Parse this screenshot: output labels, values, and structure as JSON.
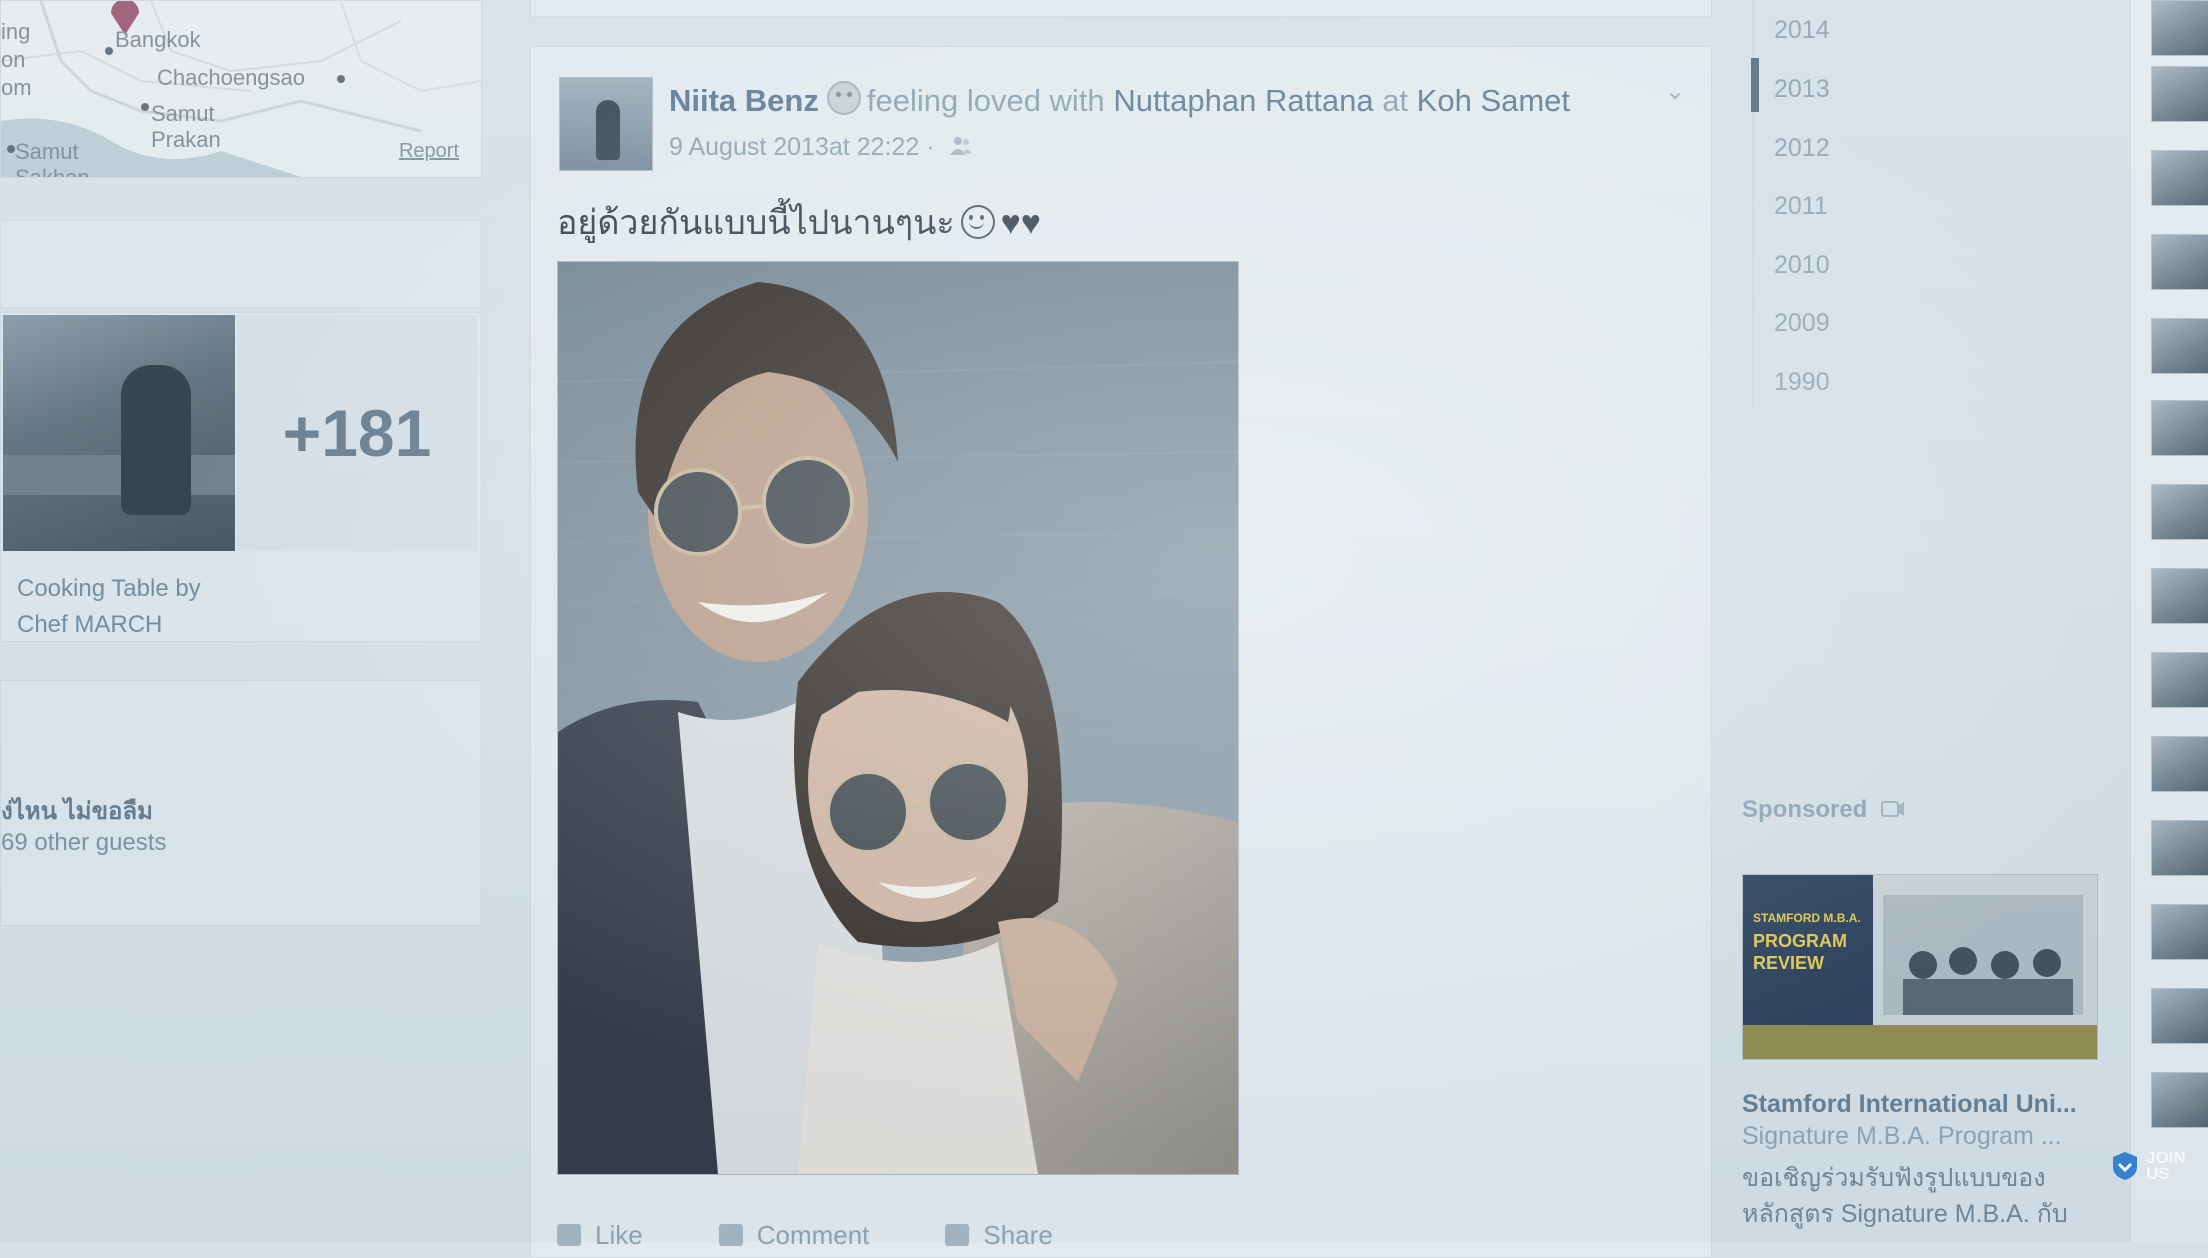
{
  "map": {
    "labels": [
      "ing",
      "on",
      "om",
      "Bangkok",
      "Chachoengsao",
      "Samut",
      "Prakan",
      "Samut",
      "Sakhon"
    ],
    "report": "Report"
  },
  "photos": {
    "more_count": "+181",
    "caption": "Cooking Table by Chef MARCH"
  },
  "event": {
    "title": "ง่ไหน ไม่ขอลืม",
    "subtitle": "69 other guests"
  },
  "post": {
    "author": "Niita Benz",
    "feeling": "feeling loved with",
    "tagged": "Nuttaphan Rattana",
    "at": "at",
    "place": "Koh Samet",
    "date": "9 August 2013at 22:22 ·",
    "text": "อยู่ด้วยกันแบบนี้ไปนานๆนะ",
    "hearts": "♥♥",
    "actions": {
      "like": "Like",
      "comment": "Comment",
      "share": "Share"
    }
  },
  "timeline": {
    "years": [
      "2014",
      "2013",
      "2012",
      "2011",
      "2010",
      "2009",
      "1990"
    ],
    "selected": "2013"
  },
  "ad": {
    "sponsored": "Sponsored",
    "image_text": [
      "STAMFORD M.B.A.",
      "PROGRAM",
      "REVIEW"
    ],
    "title": "Stamford International Uni...",
    "subtitle": "Signature M.B.A. Program ...",
    "description": "ขอเชิญร่วมรับฟังรูปแบบของ หลักสูตร Signature M.B.A. กับ"
  },
  "watermark": {
    "line1": "JOIN",
    "line2": "US"
  },
  "colors": {
    "page_bg": "#d6e0e7",
    "card_bg": "#e2eaef",
    "link": "#5d7b96"
  }
}
